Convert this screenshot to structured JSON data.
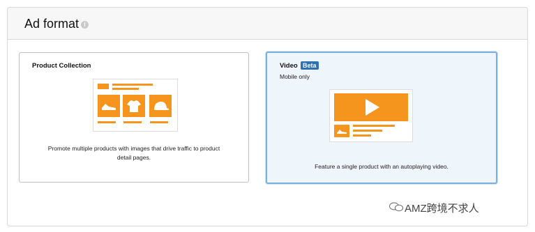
{
  "section": {
    "title": "Ad format",
    "info_icon": "info-icon"
  },
  "cards": {
    "product_collection": {
      "title": "Product Collection",
      "description": "Promote multiple products with images that drive traffic to product detail pages.",
      "selected": false
    },
    "video": {
      "title": "Video",
      "badge": "Beta",
      "subtitle": "Mobile only",
      "description": "Feature a single product with an autoplaying video.",
      "selected": true
    }
  },
  "watermark": {
    "text": "AMZ跨境不求人",
    "icon": "wechat-icon"
  },
  "colors": {
    "accent_orange": "#f5951e",
    "selected_border": "#79b0dd",
    "selected_bg": "#eef5fb",
    "badge_blue": "#2f6fb6"
  }
}
